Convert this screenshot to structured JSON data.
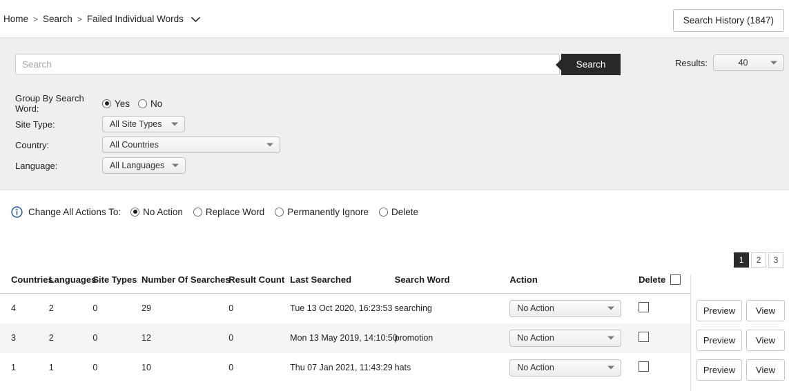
{
  "breadcrumb": {
    "items": [
      "Home",
      "Search",
      "Failed Individual Words"
    ],
    "separator": ">",
    "caret_icon": "chevron-down-icon"
  },
  "header": {
    "search_history_label": "Search History (1847)"
  },
  "filters": {
    "search": {
      "placeholder": "Search",
      "value": "",
      "button_label": "Search"
    },
    "results": {
      "label": "Results:",
      "value": "40"
    },
    "group_by_search_word": {
      "label": "Group By Search Word:",
      "options": [
        "Yes",
        "No"
      ],
      "selected": "Yes"
    },
    "site_type": {
      "label": "Site Type:",
      "value": "All Site Types"
    },
    "country": {
      "label": "Country:",
      "value": "All Countries"
    },
    "language": {
      "label": "Language:",
      "value": "All Languages"
    }
  },
  "change_all_actions": {
    "info_icon": "info-circle-icon",
    "label": "Change All Actions To:",
    "options": [
      "No Action",
      "Replace Word",
      "Permanently Ignore",
      "Delete"
    ],
    "selected": "No Action"
  },
  "pagination": {
    "pages": [
      "1",
      "2",
      "3"
    ],
    "current": "1"
  },
  "table": {
    "headers": {
      "countries": "Countries",
      "languages": "Languages",
      "site_types": "Site Types",
      "number_of_searches": "Number Of Searches",
      "result_count": "Result Count",
      "last_searched": "Last Searched",
      "search_word": "Search Word",
      "action": "Action",
      "delete": "Delete"
    },
    "rows": [
      {
        "countries": "4",
        "languages": "2",
        "site_types": "0",
        "number_of_searches": "29",
        "result_count": "0",
        "last_searched": "Tue 13 Oct 2020, 16:23:53",
        "search_word": "searching",
        "action": "No Action",
        "delete_checked": false
      },
      {
        "countries": "3",
        "languages": "2",
        "site_types": "0",
        "number_of_searches": "12",
        "result_count": "0",
        "last_searched": "Mon 13 May 2019, 14:10:50",
        "search_word": "promotion",
        "action": "No Action",
        "delete_checked": false
      },
      {
        "countries": "1",
        "languages": "1",
        "site_types": "0",
        "number_of_searches": "10",
        "result_count": "0",
        "last_searched": "Thu 07 Jan 2021, 11:43:29",
        "search_word": "hats",
        "action": "No Action",
        "delete_checked": false
      }
    ],
    "row_buttons": {
      "preview_label": "Preview",
      "view_label": "View"
    }
  },
  "colors": {
    "panel_background": "#efefef",
    "search_button": "#282828",
    "accent_info": "#13518f",
    "row_alt": "#f5f5f5"
  }
}
